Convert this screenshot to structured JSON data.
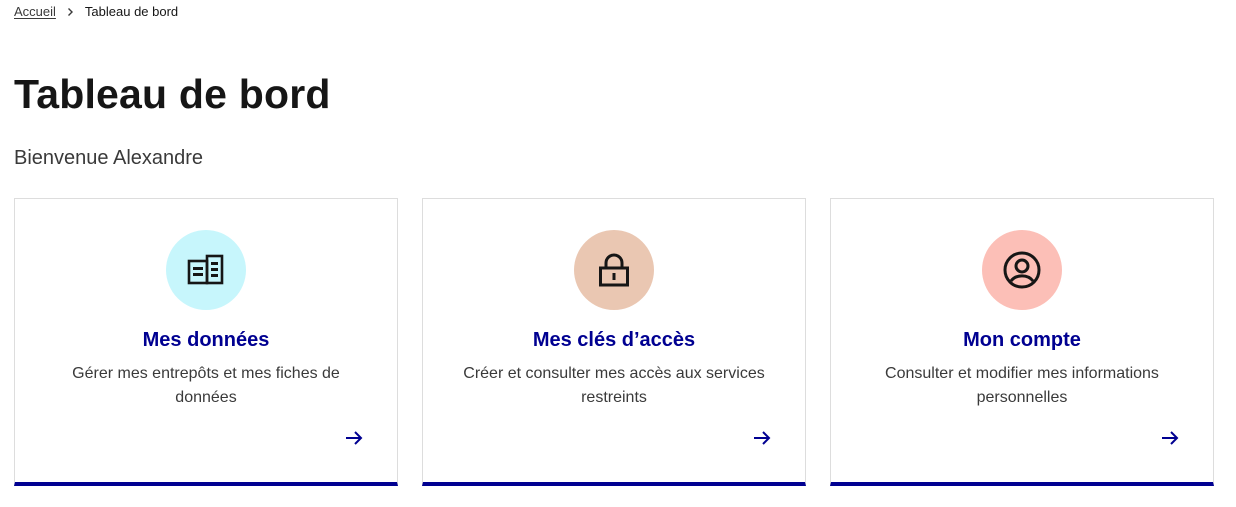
{
  "breadcrumb": {
    "home_label": "Accueil",
    "current_label": "Tableau de bord"
  },
  "page": {
    "title": "Tableau de bord",
    "welcome": "Bienvenue Alexandre"
  },
  "cards": [
    {
      "title": "Mes données",
      "description": "Gérer mes entrepôts et mes fiches de données",
      "icon": "building-icon",
      "icon_bg": "#c7f6fc"
    },
    {
      "title": "Mes clés d’accès",
      "description": "Créer et consulter mes accès aux services restreints",
      "icon": "lock-icon",
      "icon_bg": "#eac7b2"
    },
    {
      "title": "Mon compte",
      "description": "Consulter et modifier mes informations personnelles",
      "icon": "user-circle-icon",
      "icon_bg": "#fcbfb7"
    }
  ],
  "colors": {
    "accent": "#000091",
    "text": "#161616",
    "muted_text": "#3a3a3a",
    "card_border": "#dddddd"
  }
}
